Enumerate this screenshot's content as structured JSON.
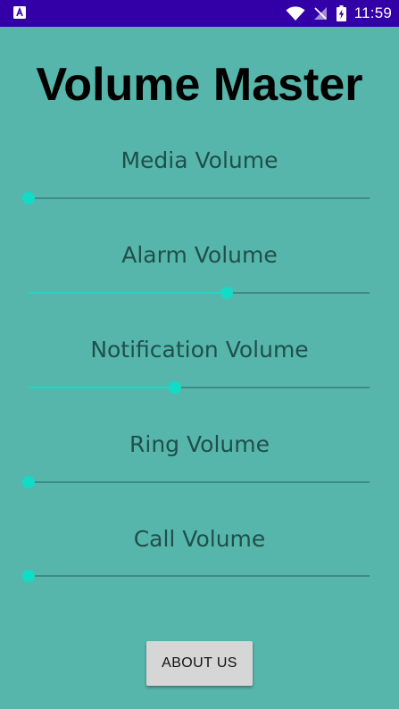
{
  "status_bar": {
    "time": "11:59",
    "icons": [
      "app-notification-icon",
      "wifi-icon",
      "no-signal-icon",
      "battery-charging-icon"
    ],
    "background": "#3300a8"
  },
  "title": "Volume Master",
  "volumes": [
    {
      "label": "Media Volume",
      "level": 0.0
    },
    {
      "label": "Alarm Volume",
      "level": 0.58
    },
    {
      "label": "Notification Volume",
      "level": 0.43
    },
    {
      "label": "Ring Volume",
      "level": 0.0
    },
    {
      "label": "Call Volume",
      "level": 0.0
    }
  ],
  "about_button": "ABOUT US",
  "colors": {
    "background": "#57b6ab",
    "accent": "#12dbc6",
    "label": "#1f4f4b"
  }
}
